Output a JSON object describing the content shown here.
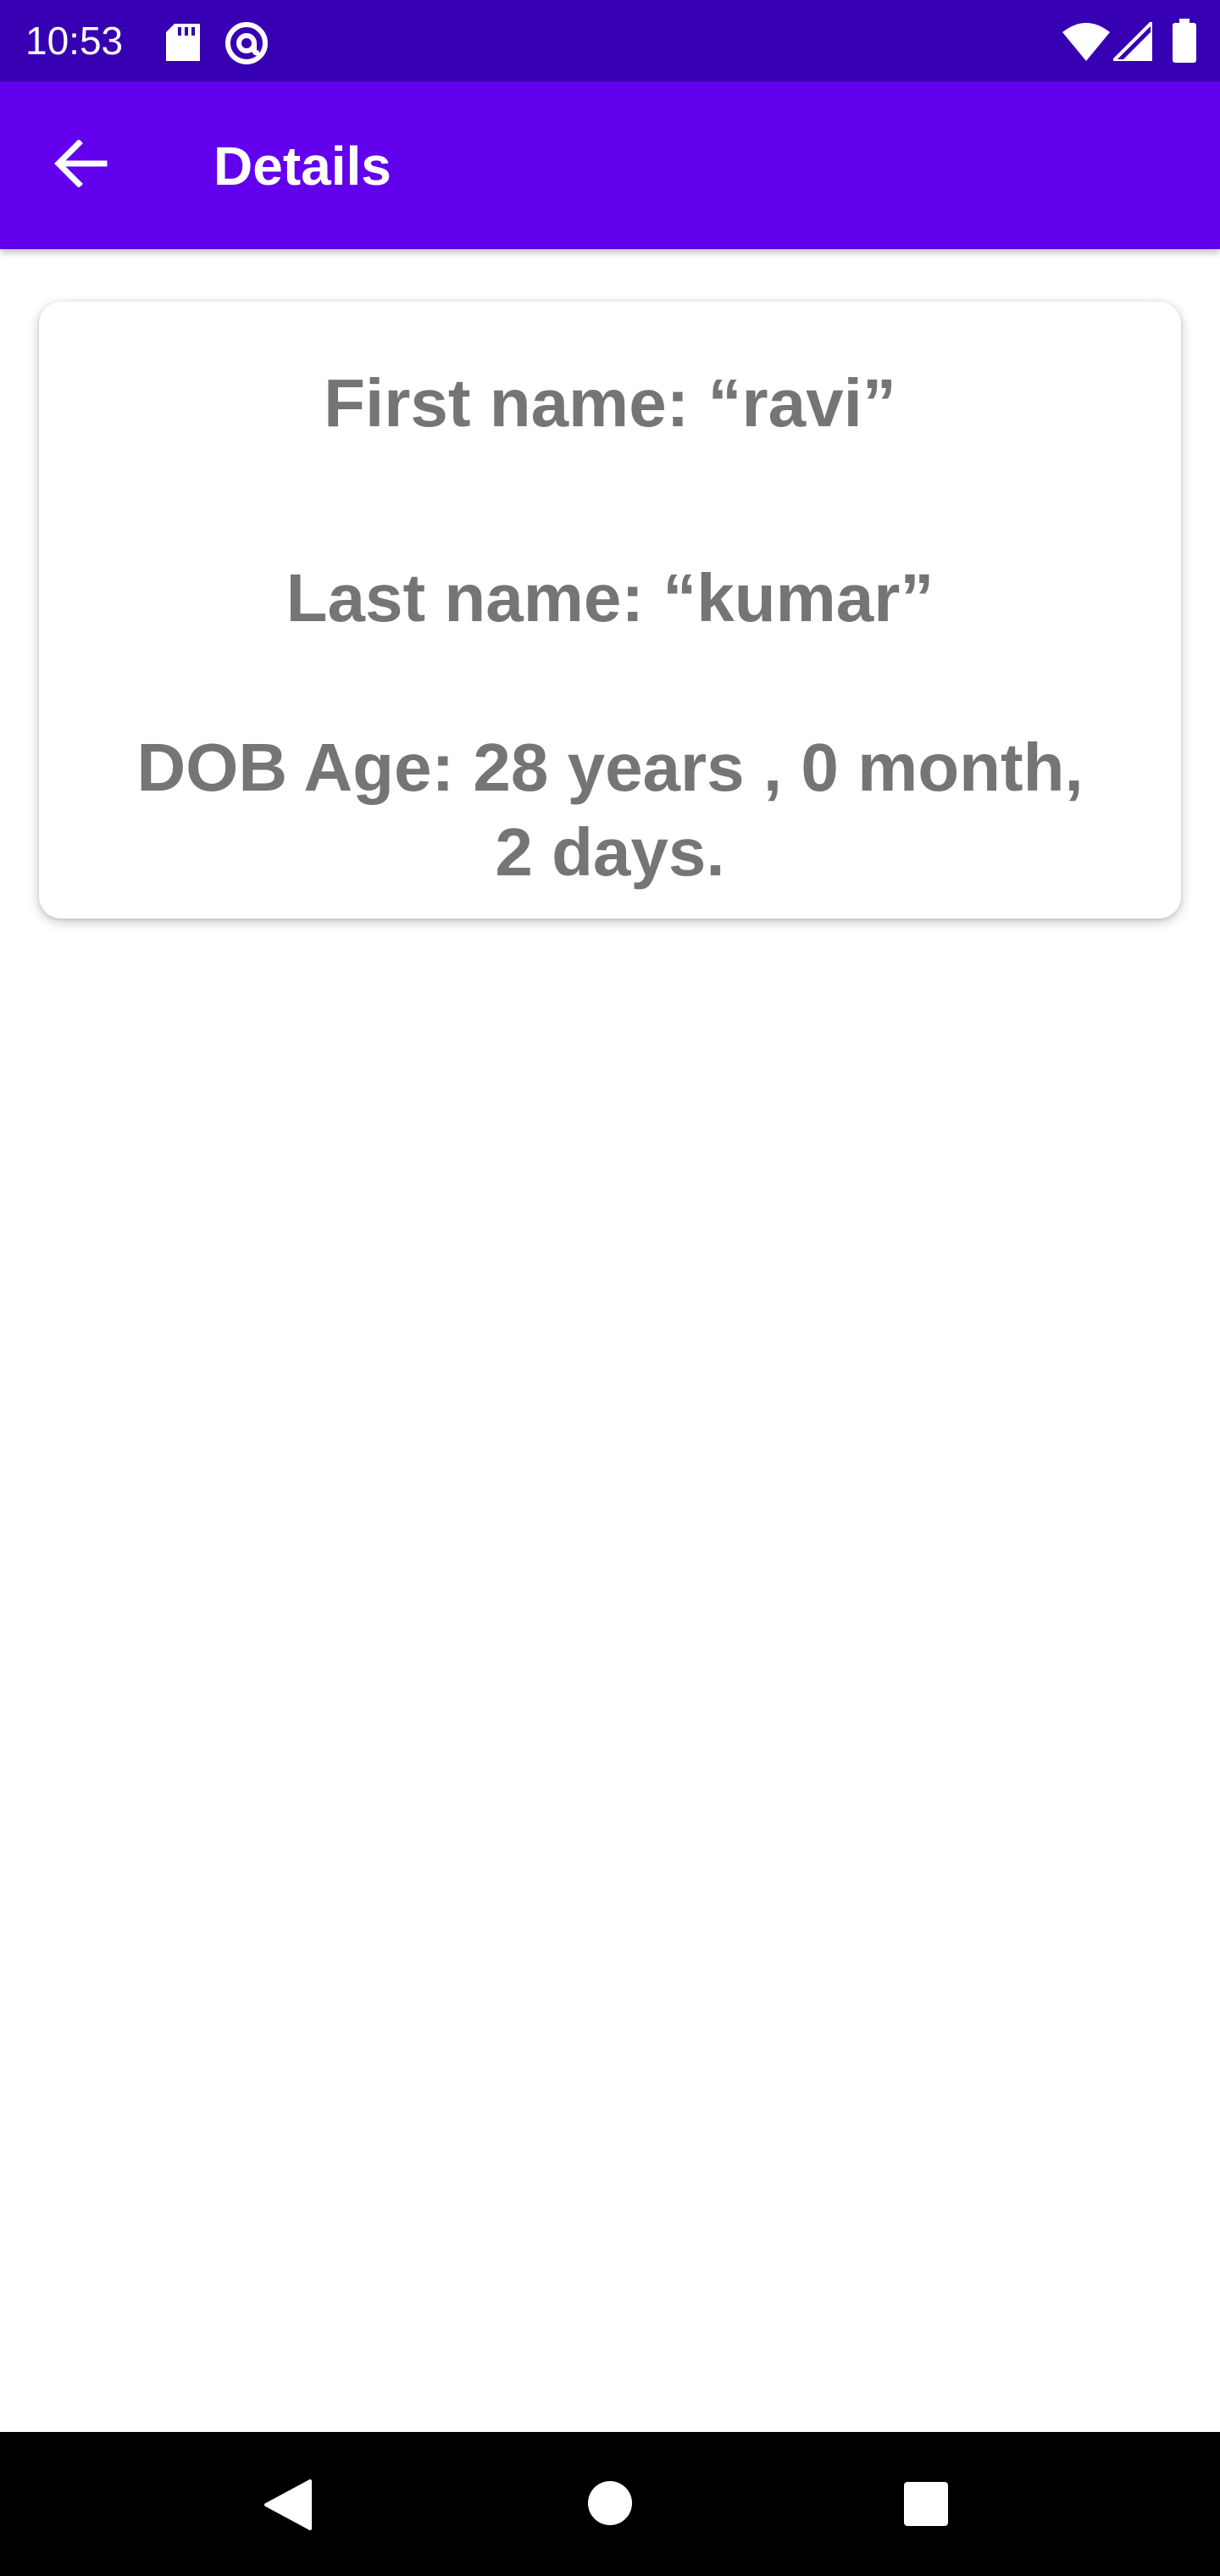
{
  "status_bar": {
    "time": "10:53",
    "icons": [
      "sd-card-icon",
      "at-sign-icon",
      "wifi-icon",
      "cell-signal-icon",
      "battery-icon"
    ]
  },
  "app_bar": {
    "title": "Details",
    "back_icon": "arrow-back-icon",
    "background_color": "#6200EE"
  },
  "details": {
    "first_name": "First name: “ravi”",
    "last_name": "Last name: “kumar”",
    "dob_line1": "DOB Age: 28 years , 0 month,",
    "dob_line2": "2 days."
  },
  "navigation_bar": {
    "buttons": [
      "back-triangle-icon",
      "home-circle-icon",
      "recents-square-icon"
    ]
  },
  "colors": {
    "status_bar": "#3700B3",
    "app_bar": "#6200EE",
    "detail_text": "#757575"
  }
}
